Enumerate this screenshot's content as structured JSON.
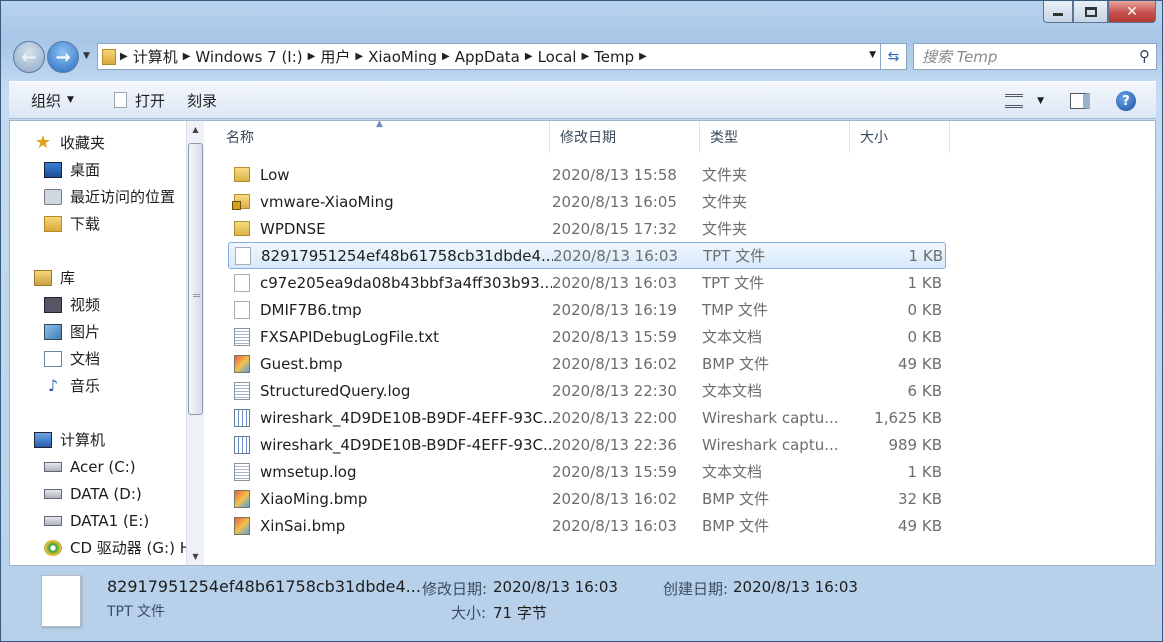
{
  "window": {
    "minimize": "",
    "maximize": "",
    "close": "✕"
  },
  "address": {
    "crumbs": [
      "计算机",
      "Windows 7 (I:)",
      "用户",
      "XiaoMing",
      "AppData",
      "Local",
      "Temp"
    ],
    "search_placeholder": "搜索 Temp"
  },
  "toolbar": {
    "organize": "组织",
    "open": "打开",
    "burn": "刻录"
  },
  "navpane": {
    "favorites": "收藏夹",
    "desktop": "桌面",
    "recent": "最近访问的位置",
    "downloads": "下载",
    "libraries": "库",
    "videos": "视频",
    "pictures": "图片",
    "documents": "文档",
    "music": "音乐",
    "computer": "计算机",
    "drive_c": "Acer (C:)",
    "drive_d": "DATA (D:)",
    "drive_e": "DATA1 (E:)",
    "drive_g": "CD 驱动器 (G:) H"
  },
  "columns": {
    "name": "名称",
    "date": "修改日期",
    "type": "类型",
    "size": "大小"
  },
  "files": [
    {
      "name": "Low",
      "date": "2020/8/13 15:58",
      "type": "文件夹",
      "size": "",
      "icon": "folder-icon"
    },
    {
      "name": "vmware-XiaoMing",
      "date": "2020/8/13 16:05",
      "type": "文件夹",
      "size": "",
      "icon": "locked-folder-icon"
    },
    {
      "name": "WPDNSE",
      "date": "2020/8/15 17:32",
      "type": "文件夹",
      "size": "",
      "icon": "folder-icon"
    },
    {
      "name": "82917951254ef48b61758cb31dbde4...",
      "date": "2020/8/13 16:03",
      "type": "TPT 文件",
      "size": "1 KB",
      "icon": "file-icon"
    },
    {
      "name": "c97e205ea9da08b43bbf3a4ff303b93...",
      "date": "2020/8/13 16:03",
      "type": "TPT 文件",
      "size": "1 KB",
      "icon": "file-icon"
    },
    {
      "name": "DMIF7B6.tmp",
      "date": "2020/8/13 16:19",
      "type": "TMP 文件",
      "size": "0 KB",
      "icon": "file-icon"
    },
    {
      "name": "FXSAPIDebugLogFile.txt",
      "date": "2020/8/13 15:59",
      "type": "文本文档",
      "size": "0 KB",
      "icon": "text-file-icon"
    },
    {
      "name": "Guest.bmp",
      "date": "2020/8/13 16:02",
      "type": "BMP 文件",
      "size": "49 KB",
      "icon": "bitmap-icon"
    },
    {
      "name": "StructuredQuery.log",
      "date": "2020/8/13 22:30",
      "type": "文本文档",
      "size": "6 KB",
      "icon": "text-file-icon"
    },
    {
      "name": "wireshark_4D9DE10B-B9DF-4EFF-93C...",
      "date": "2020/8/13 22:00",
      "type": "Wireshark captu...",
      "size": "1,625 KB",
      "icon": "capture-file-icon"
    },
    {
      "name": "wireshark_4D9DE10B-B9DF-4EFF-93C...",
      "date": "2020/8/13 22:36",
      "type": "Wireshark captu...",
      "size": "989 KB",
      "icon": "capture-file-icon"
    },
    {
      "name": "wmsetup.log",
      "date": "2020/8/13 15:59",
      "type": "文本文档",
      "size": "1 KB",
      "icon": "text-file-icon"
    },
    {
      "name": "XiaoMing.bmp",
      "date": "2020/8/13 16:02",
      "type": "BMP 文件",
      "size": "32 KB",
      "icon": "bitmap-icon"
    },
    {
      "name": "XinSai.bmp",
      "date": "2020/8/13 16:03",
      "type": "BMP 文件",
      "size": "49 KB",
      "icon": "bitmap-icon"
    }
  ],
  "selected_index": 3,
  "details": {
    "name": "82917951254ef48b61758cb31dbde4...",
    "type": "TPT 文件",
    "modified_label": "修改日期:",
    "modified_value": "2020/8/13 16:03",
    "created_label": "创建日期:",
    "created_value": "2020/8/13 16:03",
    "size_label": "大小:",
    "size_value": "71 字节"
  }
}
